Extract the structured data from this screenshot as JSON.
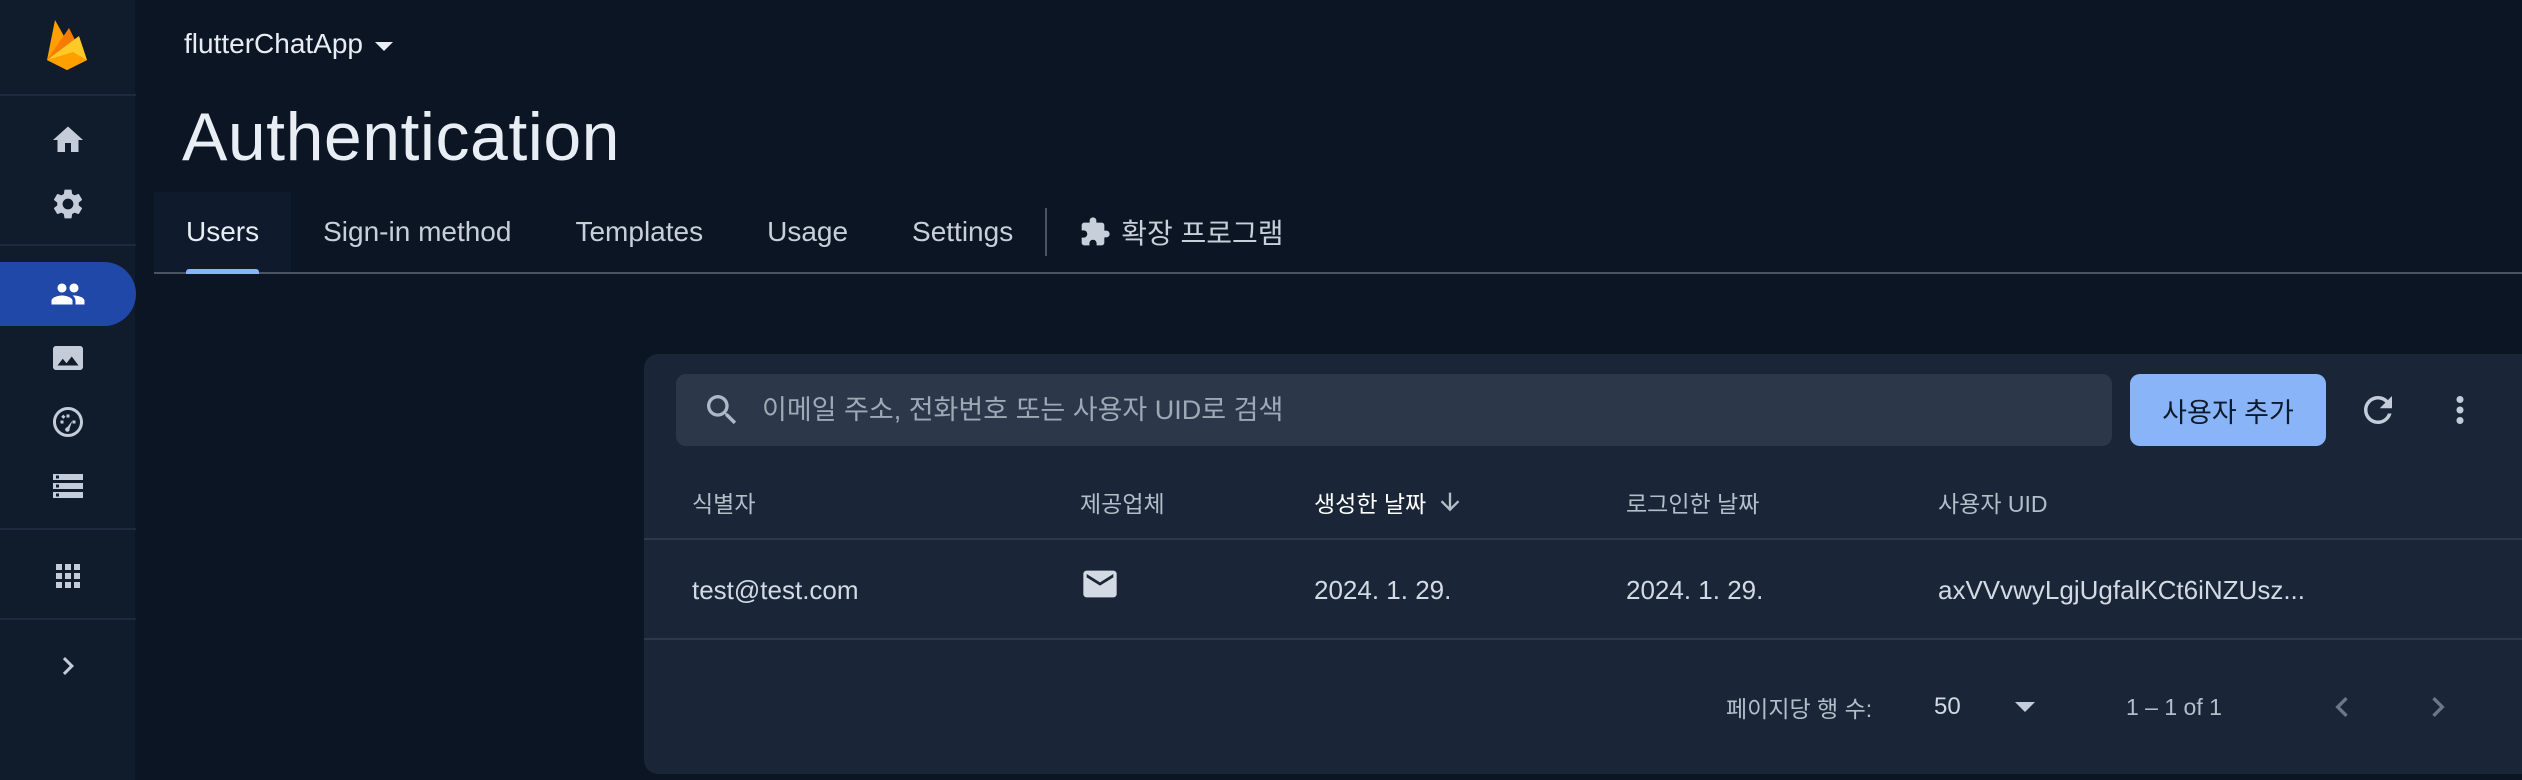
{
  "app": {
    "project_name": "flutterChatApp",
    "page_title": "Authentication"
  },
  "rail": {
    "items": [
      {
        "icon": "home-icon"
      },
      {
        "icon": "gear-icon"
      },
      {
        "icon": "people-icon",
        "active": true
      },
      {
        "icon": "image-icon"
      },
      {
        "icon": "speedometer-icon"
      },
      {
        "icon": "storage-icon"
      },
      {
        "icon": "apps-grid-icon"
      },
      {
        "icon": "chevron-right-icon"
      }
    ]
  },
  "tabs": {
    "users": "Users",
    "signin": "Sign-in method",
    "templates": "Templates",
    "usage": "Usage",
    "settings": "Settings",
    "extensions": "확장 프로그램"
  },
  "search": {
    "placeholder": "이메일 주소, 전화번호 또는 사용자 UID로 검색"
  },
  "toolbar": {
    "add_user_label": "사용자 추가"
  },
  "table": {
    "headers": {
      "identifier": "식별자",
      "provider": "제공업체",
      "created": "생성한 날짜",
      "signed_in": "로그인한 날짜",
      "uid": "사용자 UID"
    },
    "rows": [
      {
        "identifier": "test@test.com",
        "provider_icon": "email-icon",
        "created": "2024. 1. 29.",
        "signed_in": "2024. 1. 29.",
        "uid": "axVVvwyLgjUgfalKCt6iNZUsz..."
      }
    ]
  },
  "pagination": {
    "rows_per_page_label": "페이지당 행 수:",
    "rows_per_page_value": "50",
    "range": "1 – 1 of 1"
  },
  "colors": {
    "background": "#0b1524",
    "card": "#1a2637",
    "accent": "#8ab4f8",
    "active_nav": "#1f48a8"
  }
}
